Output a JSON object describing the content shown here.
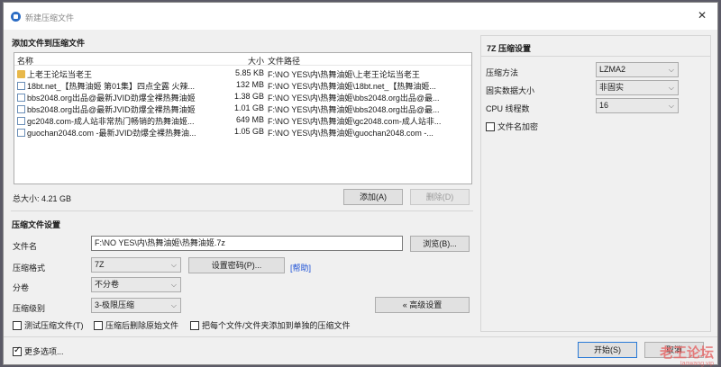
{
  "window": {
    "title": "新建压缩文件"
  },
  "add_section": {
    "title": "添加文件到压缩文件",
    "columns": {
      "name": "名称",
      "size": "大小",
      "path": "文件路径"
    },
    "files": [
      {
        "name": "上老王论坛当老王",
        "size": "5.85 KB",
        "path": "F:\\NO YES\\内\\热舞油姬\\上老王论坛当老王",
        "icon": "folder"
      },
      {
        "name": "18bt.net_【热舞油姬 第01集】四点全露 火辣...",
        "size": "132 MB",
        "path": "F:\\NO YES\\内\\热舞油姬\\18bt.net_【热舞油姬...",
        "icon": "file"
      },
      {
        "name": "bbs2048.org出品@最新JVID劲爆全裸热舞油姬...",
        "size": "1.38 GB",
        "path": "F:\\NO YES\\内\\热舞油姬\\bbs2048.org出品@最...",
        "icon": "file"
      },
      {
        "name": "bbs2048.org出品@最新JVID劲爆全裸热舞油姬...",
        "size": "1.01 GB",
        "path": "F:\\NO YES\\内\\热舞油姬\\bbs2048.org出品@最...",
        "icon": "file"
      },
      {
        "name": "gc2048.com-成人站非常热门畅销的热舞油姬...",
        "size": "649 MB",
        "path": "F:\\NO YES\\内\\热舞油姬\\gc2048.com-成人站非...",
        "icon": "file"
      },
      {
        "name": "guochan2048.com -最新JVID劲爆全裸热舞油...",
        "size": "1.05 GB",
        "path": "F:\\NO YES\\内\\热舞油姬\\guochan2048.com -...",
        "icon": "file"
      }
    ],
    "total_size": "总大小: 4.21 GB",
    "add_button": "添加(A)",
    "delete_button": "删除(D)"
  },
  "compress_section": {
    "title": "压缩文件设置",
    "filename_label": "文件名",
    "filename_value": "F:\\NO YES\\内\\热舞油姬\\热舞油姬.7z",
    "browse_button": "浏览(B)...",
    "format_label": "压缩格式",
    "format_value": "7Z",
    "password_button": "设置密码(P)...",
    "help_link": "[帮助]",
    "split_label": "分卷",
    "split_value": "不分卷",
    "level_label": "压缩级别",
    "level_value": "3-极限压缩",
    "advanced_button": "« 高级设置",
    "test_checkbox": "测试压缩文件(T)",
    "delete_source_checkbox": "压缩后删除原始文件",
    "each_separate_checkbox": "把每个文件/文件夹添加到单独的压缩文件"
  },
  "sevenz": {
    "title": "7Z 压缩设置",
    "method_label": "压缩方法",
    "method_value": "LZMA2",
    "dict_label": "固实数据大小",
    "dict_value": "非固实",
    "threads_label": "CPU 线程数",
    "threads_value": "16",
    "encrypt_names": "文件名加密"
  },
  "footer": {
    "more_options": "更多选项...",
    "start_button": "开始(S)",
    "cancel_button": "取消"
  },
  "watermark": {
    "main": "老王论坛",
    "sub": "laowang.vip"
  }
}
